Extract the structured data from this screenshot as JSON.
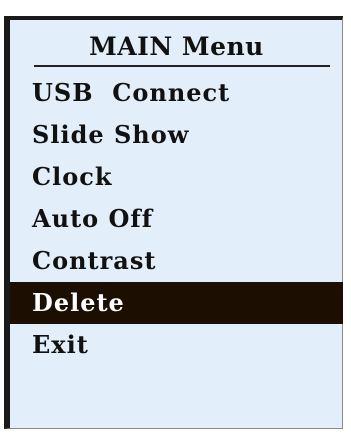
{
  "menu": {
    "title": "MAIN Menu",
    "selected_index": 5,
    "items": [
      {
        "label": "USB  Connect"
      },
      {
        "label": "Slide Show"
      },
      {
        "label": "Clock"
      },
      {
        "label": "Auto Off"
      },
      {
        "label": "Contrast"
      },
      {
        "label": "Delete"
      },
      {
        "label": "Exit"
      }
    ]
  },
  "colors": {
    "panel_background": "#e3eefb",
    "selection_background": "#1c0e00",
    "text": "#111111",
    "selected_text": "#ffffff"
  }
}
